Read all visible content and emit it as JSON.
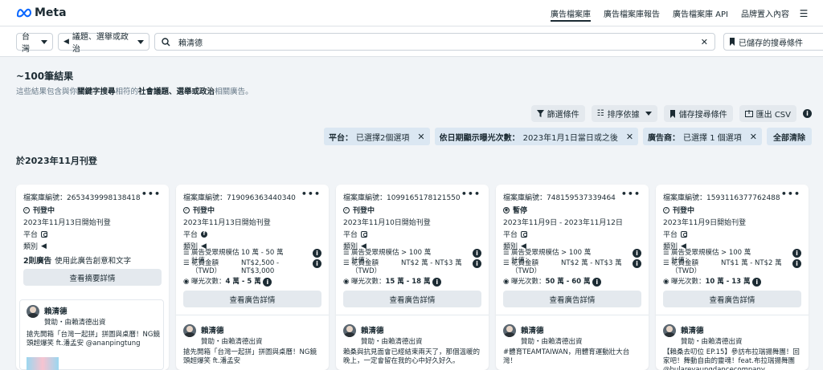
{
  "nav": {
    "brand": "Meta",
    "links": [
      "廣告檔案庫",
      "廣告檔案庫報告",
      "廣告檔案庫 API",
      "品牌置入內容"
    ],
    "active_index": 0
  },
  "search": {
    "country": "台灣",
    "category": "議題、選舉或政治",
    "query": "賴清德",
    "saved_label": "已儲存的搜尋條件"
  },
  "results": {
    "count": "~100筆結果",
    "sub_prefix": "這些結果包含與你",
    "sub_bold1": "關鍵字搜尋",
    "sub_mid": "相符的",
    "sub_bold2": "社會議題、選舉或政治",
    "sub_suffix": "相關廣告。"
  },
  "toolbar": {
    "filters": "篩選條件",
    "sort": "排序依據",
    "save_search": "儲存搜尋條件",
    "export": "匯出 CSV"
  },
  "chips": [
    {
      "label": "平台：",
      "value": "已選擇2個選項"
    },
    {
      "label": "依日期顯示曝光次數：",
      "value": "2023年1月1日當日或之後"
    },
    {
      "label": "廣告商：",
      "value": "已選擇 1 個選項"
    }
  ],
  "clear_all": "全部清除",
  "month_heading": "於2023年11月刊登",
  "cards": [
    {
      "library_id": "檔案庫編號：2653439998138418",
      "status": "刊登中",
      "date": "2023年11月13日開始刊登",
      "platform_label": "平台",
      "category_label": "類別",
      "note_bold": "2則廣告",
      "note_rest": "使用此廣告創意和文字",
      "button": "查看摘要詳情",
      "advertiser": "賴清德",
      "sponsor": "贊助・由賴清德出資",
      "text": "搶先開箱「台灣一起拼」拼圖與桌曆！NG鏡頭超爆笑 ft.潘孟安 @ananpingtung"
    },
    {
      "library_id": "檔案庫編號：719096363440340",
      "status": "刊登中",
      "date": "2023年11月13日開始刊登",
      "platform_label": "平台",
      "category_label": "類別",
      "aud_label": "廣告受眾規模估計值",
      "aud_value": "10 萬 - 50 萬",
      "spend_label": "花費金額（TWD）",
      "spend_value": "NT$2,500 - NT$3,000",
      "imp_label": "曝光次數：",
      "imp_value": "4 萬 - 5 萬",
      "button": "查看廣告詳情",
      "advertiser": "賴清德",
      "sponsor": "贊助・由賴清德出資",
      "text": "搶先開箱「台灣一起拼」拼圖與桌曆！NG鏡頭超爆笑 ft.潘孟安"
    },
    {
      "library_id": "檔案庫編號：1099165178121550",
      "status": "刊登中",
      "date": "2023年11月10日開始刊登",
      "platform_label": "平台",
      "category_label": "類別",
      "aud_label": "廣告受眾規模估計值：",
      "aud_value": "> 100 萬",
      "spend_label": "花費金額（TWD）",
      "spend_value": "NT$2 萬 - NT$3 萬",
      "imp_label": "曝光次數：",
      "imp_value": "15 萬 - 18 萬",
      "button": "查看廣告詳情",
      "advertiser": "賴清德",
      "sponsor": "贊助・由賴清德出資",
      "text": "賴桑與抗見面會已經結束兩天了，那個溫暖的晚上，一定會留在我的心中好久好久。"
    },
    {
      "library_id": "檔案庫編號：748159537339464",
      "status": "暫停",
      "date": "2023年11月9日 - 2023年11月12日",
      "platform_label": "平台",
      "category_label": "類別",
      "aud_label": "廣告受眾規模估計值：",
      "aud_value": "> 100 萬",
      "spend_label": "花費金額（TWD）",
      "spend_value": "NT$2 萬 - NT$3 萬",
      "imp_label": "曝光次數：",
      "imp_value": "50 萬 - 60 萬",
      "button": "查看廣告詳情",
      "advertiser": "賴清德",
      "sponsor": "贊助・由賴清德出資",
      "text": "#體育TEAMTAIWAN，用體育運動壯大台灣！"
    },
    {
      "library_id": "檔案庫編號：1593116377762488",
      "status": "刊登中",
      "date": "2023年11月9日開始刊登",
      "platform_label": "平台",
      "category_label": "類別",
      "aud_label": "廣告受眾規模估計值：",
      "aud_value": "> 100 萬",
      "spend_label": "花費金額（TWD）",
      "spend_value": "NT$1 萬 - NT$2 萬",
      "imp_label": "曝光次數：",
      "imp_value": "10 萬 - 13 萬",
      "button": "查看廣告詳情",
      "advertiser": "賴清德",
      "sponsor": "贊助・由賴清德出資",
      "text": "【賴桑去叨位 EP.15】參訪布拉瑞揚舞團！回家吧！舞動自由的靈魂！feat.布拉瑞揚舞團 @bulareyaungdancecompany"
    }
  ]
}
